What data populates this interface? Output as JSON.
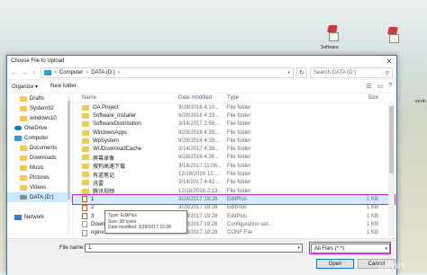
{
  "desktop": {
    "icons": [
      {
        "label": "Software",
        "icon": "winrar-icon"
      },
      {
        "label": "",
        "icon": "winrar-icon"
      }
    ],
    "right_label": "ecvin",
    "watermark": "gavin"
  },
  "dialog": {
    "title": "Choose File to Upload",
    "close": "✕"
  },
  "address": {
    "back": "←",
    "forward": "→",
    "up": "↑",
    "segments": [
      "Computer",
      "DATA (D:)"
    ],
    "separator": ">",
    "refresh": "↻",
    "search_placeholder": "Search DATA (D:)"
  },
  "toolbar": {
    "organize": "Organize ▾",
    "new_folder": "New folder"
  },
  "nav": {
    "items": [
      {
        "label": "Drafts",
        "icon": "folder-icon",
        "top": false
      },
      {
        "label": "System32",
        "icon": "folder-icon",
        "top": false
      },
      {
        "label": "windows10",
        "icon": "folder-icon",
        "top": false
      },
      {
        "label": "OneDrive",
        "icon": "cloud-icon",
        "top": true
      },
      {
        "label": "Computer",
        "icon": "computer-icon",
        "top": true
      },
      {
        "label": "Documents",
        "icon": "folder-icon",
        "top": false
      },
      {
        "label": "Downloads",
        "icon": "folder-icon",
        "top": false
      },
      {
        "label": "Music",
        "icon": "folder-icon",
        "top": false
      },
      {
        "label": "Pictures",
        "icon": "folder-icon",
        "top": false
      },
      {
        "label": "Videos",
        "icon": "folder-icon",
        "top": false
      },
      {
        "label": "DATA (D:)",
        "icon": "drive-icon",
        "top": false,
        "selected": true
      },
      {
        "label": "",
        "icon": "",
        "top": false
      },
      {
        "label": "Network",
        "icon": "network-icon",
        "top": true
      }
    ]
  },
  "columns": {
    "name": "Name",
    "date": "Date modified",
    "type": "Type",
    "size": "Size"
  },
  "files": [
    {
      "name": "OA Project",
      "date": "9/28/2016 4:10...",
      "type": "File folder",
      "size": "",
      "icon": "folder-icon"
    },
    {
      "name": "Software_Installer",
      "date": "6/28/2016 4:33...",
      "type": "File folder",
      "size": "",
      "icon": "folder-icon"
    },
    {
      "name": "SoftwareDistribution",
      "date": "3/14/2017 2:56...",
      "type": "File folder",
      "size": "",
      "icon": "folder-icon"
    },
    {
      "name": "WindowsApps",
      "date": "9/28/2016 4:39...",
      "type": "File folder",
      "size": "",
      "icon": "folder-icon"
    },
    {
      "name": "WpSystem",
      "date": "9/28/2016 4:39...",
      "type": "File folder",
      "size": "",
      "icon": "folder-icon"
    },
    {
      "name": "WUDownloadCache",
      "date": "3/14/2017 4:39...",
      "type": "File folder",
      "size": "",
      "icon": "folder-icon"
    },
    {
      "name": "屏幕录像",
      "date": "6/28/2016 4:36...",
      "type": "File folder",
      "size": "",
      "icon": "folder-icon"
    },
    {
      "name": "搜狗高速下载",
      "date": "3/14/2017 11:06...",
      "type": "File folder",
      "size": "",
      "icon": "folder-icon"
    },
    {
      "name": "有道笔记",
      "date": "12/18/2016 12:...",
      "type": "File folder",
      "size": "",
      "icon": "folder-icon"
    },
    {
      "name": "迅雷",
      "date": "3/14/2017 4:42...",
      "type": "File folder",
      "size": "",
      "icon": "folder-icon"
    },
    {
      "name": "腾讯视频",
      "date": "12/18/2016 2:13...",
      "type": "File folder",
      "size": "",
      "icon": "folder-icon"
    },
    {
      "name": "1",
      "date": "3/28/2017 19:28",
      "type": "EditPlus",
      "size": "1 KB",
      "icon": "editplus-icon",
      "selected": true
    },
    {
      "name": "2",
      "date": "3/28/2017 19:28",
      "type": "EditPlus",
      "size": "1 KB",
      "icon": "editplus-icon"
    },
    {
      "name": "3",
      "date": "3/28/2017 19:28",
      "type": "EditPlus",
      "size": "1 KB",
      "icon": "editplus-icon"
    },
    {
      "name": "Downl...",
      "date": "3/28/2017 19:28",
      "type": "Configuration set...",
      "size": "1 KB",
      "icon": "file-icon"
    },
    {
      "name": "nginx.conf",
      "date": "3/28/2017 19:28",
      "type": "CONF File",
      "size": "1 KB",
      "icon": "file-icon"
    }
  ],
  "tooltip": {
    "lines": [
      "Type: EditPlus",
      "Size: 38 bytes",
      "Date modified: 3/28/2017 19:28"
    ]
  },
  "bottom": {
    "file_name_label": "File name:",
    "file_name_value": "1",
    "filter_value": "All Files (*.*)",
    "open_label": "Open",
    "cancel_label": "Cancel"
  },
  "colors": {
    "accent": "#0078d7",
    "highlight_box": "#c02bd4",
    "selection": "#cce8ff"
  }
}
